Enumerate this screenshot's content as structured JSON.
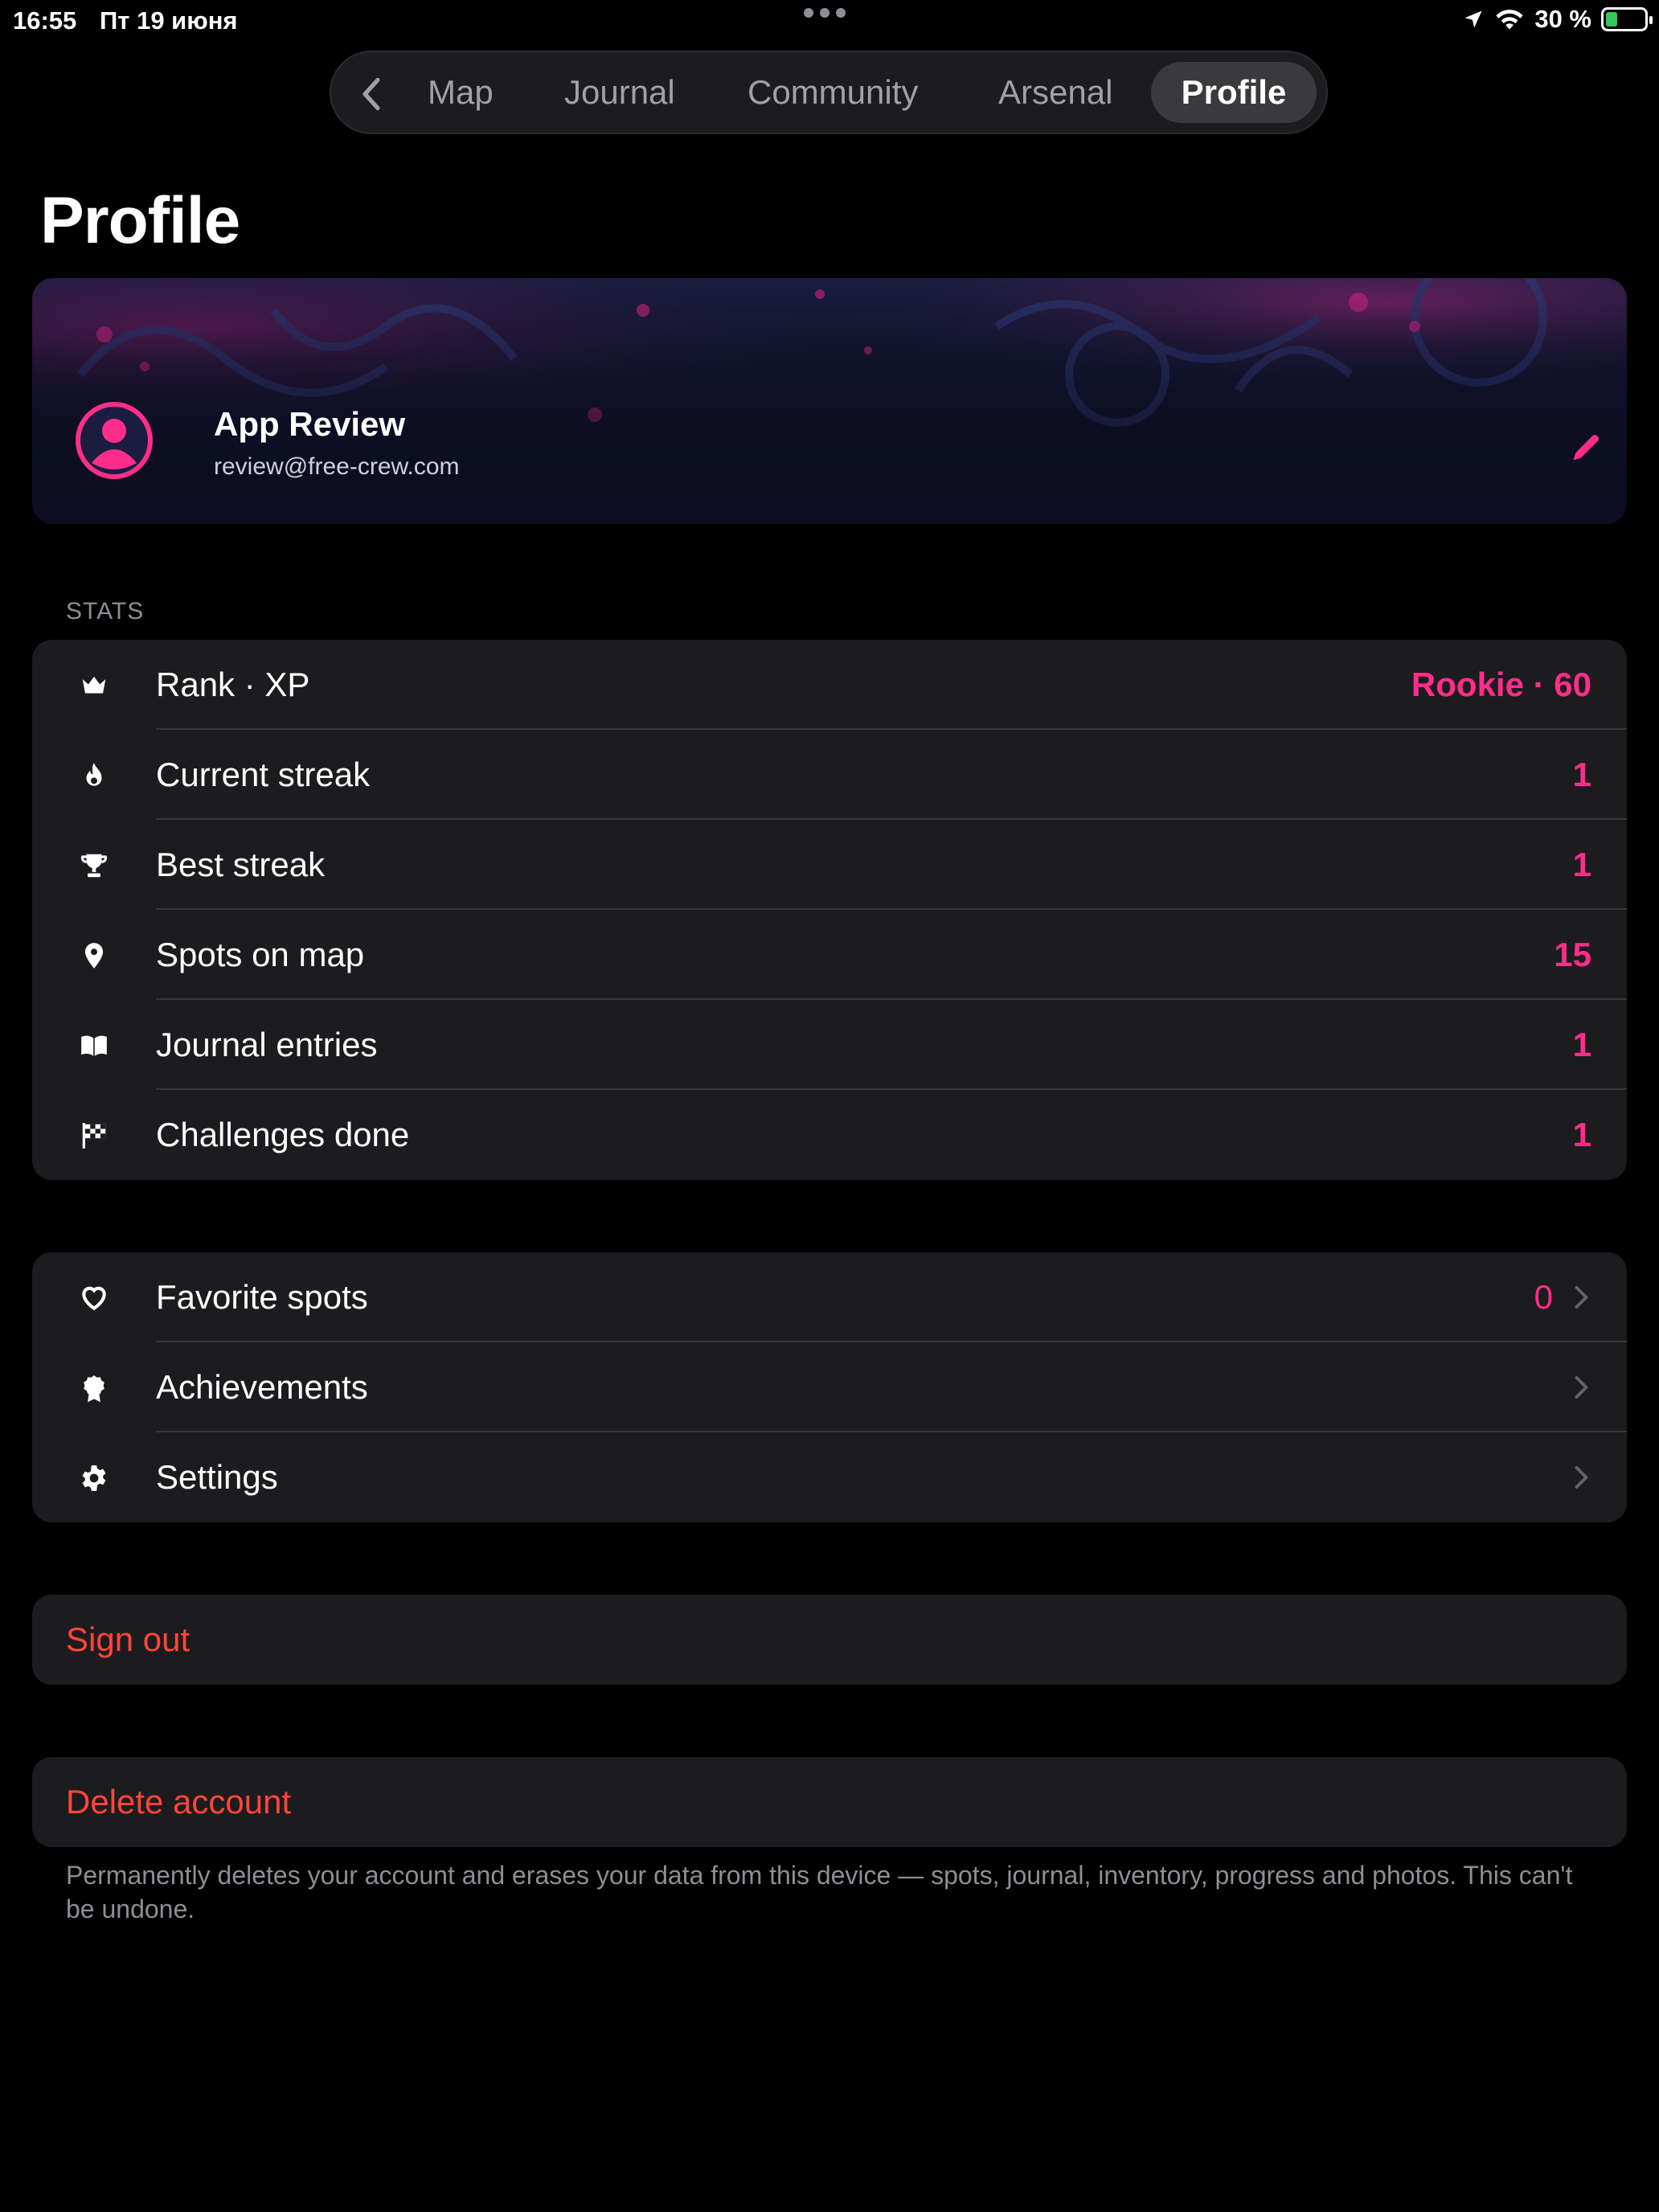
{
  "status_bar": {
    "time": "16:55",
    "date": "Пт 19 июня",
    "battery_percent": "30 %",
    "battery_level": 0.3
  },
  "tabs": {
    "back_icon": "chevron-left-icon",
    "items": [
      "Map",
      "Journal",
      "Community",
      "Arsenal"
    ],
    "active": "Profile"
  },
  "page": {
    "title": "Profile"
  },
  "profile": {
    "name": "App Review",
    "email": "review@free-crew.com",
    "avatar_icon": "person-circle-icon",
    "edit_icon": "pencil-icon"
  },
  "stats": {
    "header": "STATS",
    "rows": [
      {
        "icon": "crown-icon",
        "label": "Rank · XP",
        "value": "Rookie · 60"
      },
      {
        "icon": "flame-icon",
        "label": "Current streak",
        "value": "1"
      },
      {
        "icon": "trophy-icon",
        "label": "Best streak",
        "value": "1"
      },
      {
        "icon": "map-pin-icon",
        "label": "Spots on map",
        "value": "15"
      },
      {
        "icon": "book-icon",
        "label": "Journal entries",
        "value": "1"
      },
      {
        "icon": "checkered-flag-icon",
        "label": "Challenges done",
        "value": "1"
      }
    ]
  },
  "links": {
    "rows": [
      {
        "icon": "heart-icon",
        "label": "Favorite spots",
        "value": "0"
      },
      {
        "icon": "medal-icon",
        "label": "Achievements",
        "value": ""
      },
      {
        "icon": "gear-icon",
        "label": "Settings",
        "value": ""
      }
    ]
  },
  "actions": {
    "sign_out": "Sign out",
    "delete_account": "Delete account",
    "delete_note": "Permanently deletes your account and erases your data from this device — spots, journal, inventory, progress and photos. This can't be undone."
  },
  "colors": {
    "accent": "#ff2d8a",
    "destructive": "#ff453a",
    "background": "#000000",
    "card": "#1c1c1e"
  }
}
